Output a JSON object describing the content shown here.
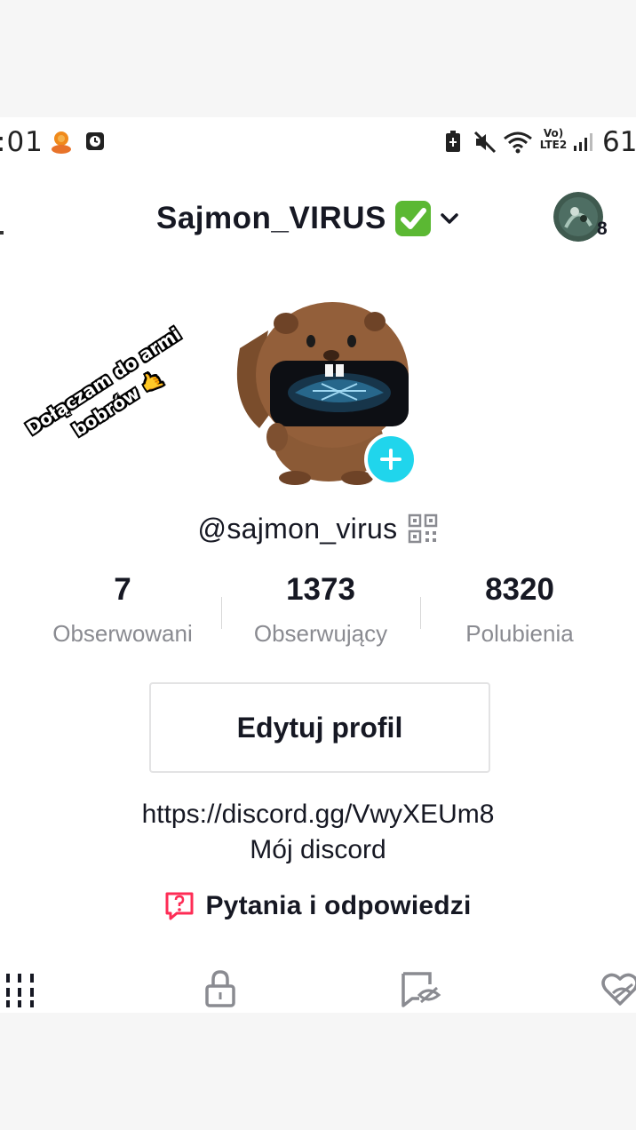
{
  "status_bar": {
    "time": ":01",
    "network": "Vo) LTE2",
    "battery": "61"
  },
  "header": {
    "title": "Sajmon_VIRUS",
    "verified_icon": "check-mark-button-emoji",
    "avatar_badge_count": "8"
  },
  "sticker": {
    "line1": "Dołączam do armi",
    "line2": "bobrów 🤙"
  },
  "profile": {
    "username": "@sajmon_virus",
    "stats": [
      {
        "value": "7",
        "label": "Obserwowani"
      },
      {
        "value": "1373",
        "label": "Obserwujący"
      },
      {
        "value": "8320",
        "label": "Polubienia"
      }
    ],
    "edit_label": "Edytuj profil",
    "bio_link": "https://discord.gg/VwyXEUm8",
    "bio_text": "Mój discord",
    "qa_label": "Pytania i odpowiedzi"
  },
  "tabs": [
    "grid-icon",
    "lock-icon",
    "hidden-saved-icon",
    "liked-hidden-icon"
  ],
  "colors": {
    "accent_cyan": "#20d5ec",
    "qa_pink": "#fe2c55",
    "text_dark": "#161823",
    "text_muted": "#8a8b91"
  }
}
